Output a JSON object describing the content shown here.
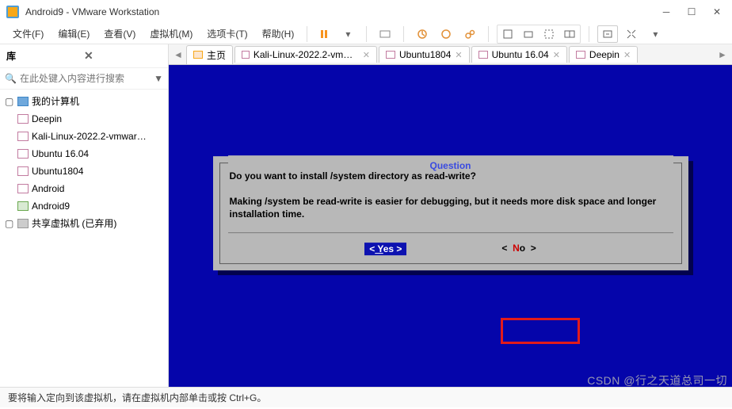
{
  "window": {
    "title": "Android9 - VMware Workstation"
  },
  "menu": {
    "file": "文件(F)",
    "edit": "编辑(E)",
    "view": "查看(V)",
    "vm": "虚拟机(M)",
    "tabs": "选项卡(T)",
    "help": "帮助(H)"
  },
  "sidebar": {
    "header": "库",
    "search_placeholder": "在此处键入内容进行搜索",
    "root": "我的计算机",
    "items": [
      {
        "label": "Deepin"
      },
      {
        "label": "Kali-Linux-2022.2-vmware-amd64"
      },
      {
        "label": "Ubuntu 16.04"
      },
      {
        "label": "Ubuntu1804"
      },
      {
        "label": "Android"
      },
      {
        "label": "Android9"
      }
    ],
    "shared": "共享虚拟机 (已弃用)"
  },
  "tabs": {
    "home": "主页",
    "items": [
      {
        "label": "Kali-Linux-2022.2-vmware-am..."
      },
      {
        "label": "Ubuntu1804"
      },
      {
        "label": "Ubuntu 16.04"
      },
      {
        "label": "Deepin"
      }
    ]
  },
  "dialog": {
    "title": "Question",
    "line1": "Do you want to install /system directory as read-write?",
    "line2": "Making /system be read-write is easier for debugging, but it needs more disk space and longer installation time.",
    "yes_pre": "<",
    "yes_mid": " Yes ",
    "yes_post": ">",
    "no_pre": "<",
    "no_mid": " No ",
    "no_post": ">"
  },
  "status": "要将输入定向到该虚拟机，请在虚拟机内部单击或按 Ctrl+G。",
  "watermark": "CSDN @行之天道总司一切"
}
